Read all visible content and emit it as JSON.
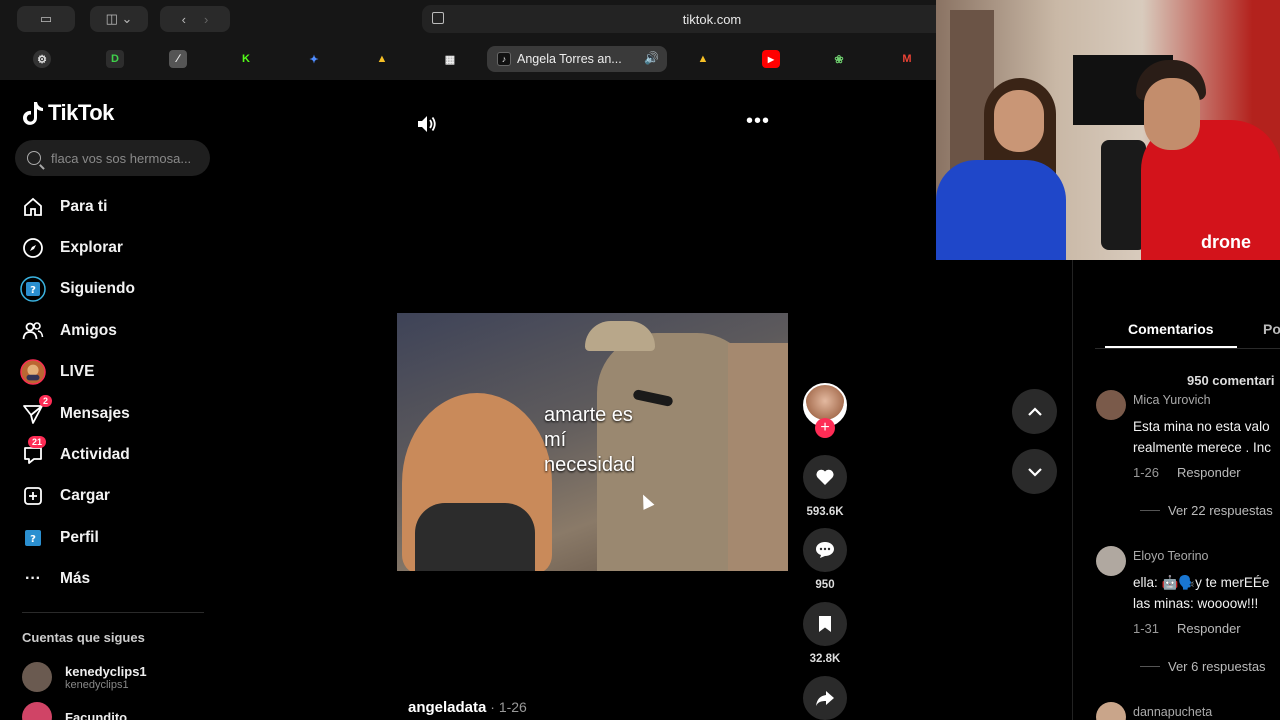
{
  "browser": {
    "url": "tiktok.com",
    "active_tab_title": "Angela Torres an...",
    "active_tab_icon": "tiktok-icon",
    "accent": "#fe2c55"
  },
  "sidebar": {
    "logo_text": "TikTok",
    "search_placeholder": "flaca vos sos hermosa...",
    "items": [
      {
        "label": "Para ti",
        "icon": "home-icon"
      },
      {
        "label": "Explorar",
        "icon": "compass-icon"
      },
      {
        "label": "Siguiendo",
        "icon": "following-icon"
      },
      {
        "label": "Amigos",
        "icon": "friends-icon"
      },
      {
        "label": "LIVE",
        "icon": "live-icon"
      },
      {
        "label": "Mensajes",
        "icon": "messages-icon",
        "badge": "2"
      },
      {
        "label": "Actividad",
        "icon": "activity-icon",
        "badge": "21"
      },
      {
        "label": "Cargar",
        "icon": "upload-icon"
      },
      {
        "label": "Perfil",
        "icon": "profile-icon"
      },
      {
        "label": "Más",
        "icon": "more-icon"
      }
    ],
    "following_title": "Cuentas que sigues",
    "accounts": [
      {
        "name": "kenedyclips1",
        "handle": "kenedyclips1"
      },
      {
        "name": "Facundito",
        "handle": ""
      }
    ]
  },
  "video": {
    "caption_lines": [
      "amarte  es",
      "mí",
      "necesidad"
    ],
    "author": "angeladata",
    "date": " · 1-26"
  },
  "actions": {
    "likes": "593.6K",
    "comments": "950",
    "saves": "32.8K"
  },
  "comments_panel": {
    "tab_active": "Comentarios",
    "tab_other": "Po",
    "count_label": "950 comentari",
    "comments": [
      {
        "user": "Mica Yurovich",
        "lines": [
          "Esta mina no esta valo",
          "realmente merece . Inc"
        ],
        "date": "1-26",
        "reply": "Responder",
        "more": "Ver 22 respuestas"
      },
      {
        "user": "Eloyo Teorino",
        "lines": [
          "ella: 🤖🗣️y te merEÉe",
          "las minas: woooow!!!"
        ],
        "date": "1-31",
        "reply": "Responder",
        "more": "Ver 6 respuestas"
      },
      {
        "user": "dannapucheta",
        "lines": [],
        "date": "",
        "reply": "",
        "more": ""
      }
    ]
  },
  "webcam": {
    "shirt_text": "drone"
  }
}
